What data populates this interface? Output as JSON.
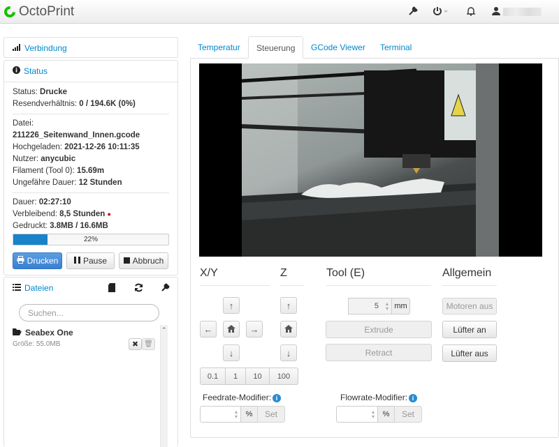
{
  "app": {
    "title": "OctoPrint"
  },
  "sidebar": {
    "connection": {
      "label": "Verbindung"
    },
    "status": {
      "label": "Status",
      "state_label": "Status:",
      "state_value": "Drucke",
      "resend_label": "Resendverhältnis:",
      "resend_value": "0 / 194.6K (0%)",
      "file_label": "Datei:",
      "file_value": "211226_Seitenwand_Innen.gcode",
      "uploaded_label": "Hochgeladen:",
      "uploaded_value": "2021-12-26 10:11:35",
      "user_label": "Nutzer:",
      "user_value": "anycubic",
      "filament_label": "Filament (Tool 0):",
      "filament_value": "15.69m",
      "est_label": "Ungefähre Dauer:",
      "est_value": "12 Stunden",
      "duration_label": "Dauer:",
      "duration_value": "02:27:10",
      "remaining_label": "Verbleibend:",
      "remaining_value": "8,5 Stunden",
      "printed_label": "Gedruckt:",
      "printed_value": "3.8MB / 16.6MB",
      "progress_text": "22%",
      "progress_fraction": 0.22
    },
    "buttons": {
      "print": "Drucken",
      "pause": "Pause",
      "cancel": "Abbruch"
    },
    "files": {
      "label": "Dateien",
      "search_placeholder": "Suchen...",
      "items": [
        {
          "name": "Seabex One",
          "size": "Größe: 55.0MB"
        }
      ]
    }
  },
  "tabs": [
    "Temperatur",
    "Steuerung",
    "GCode Viewer",
    "Terminal"
  ],
  "control": {
    "xy_title": "X/Y",
    "z_title": "Z",
    "tool_title": "Tool (E)",
    "general_title": "Allgemein",
    "steps": [
      "0.1",
      "1",
      "10",
      "100"
    ],
    "extrude_amount": "5",
    "extrude_unit": "mm",
    "extrude_label": "Extrude",
    "retract_label": "Retract",
    "motors_off": "Motoren aus",
    "fan_on": "Lüfter an",
    "fan_off": "Lüfter aus",
    "feedrate_label": "Feedrate-Modifier:",
    "flowrate_label": "Flowrate-Modifier:",
    "percent": "%",
    "set_label": "Set"
  },
  "colors": {
    "accent": "#0088cc",
    "brand": "#13c100",
    "progress": "#1a82c9",
    "primary_button": "#3a7fd0"
  }
}
